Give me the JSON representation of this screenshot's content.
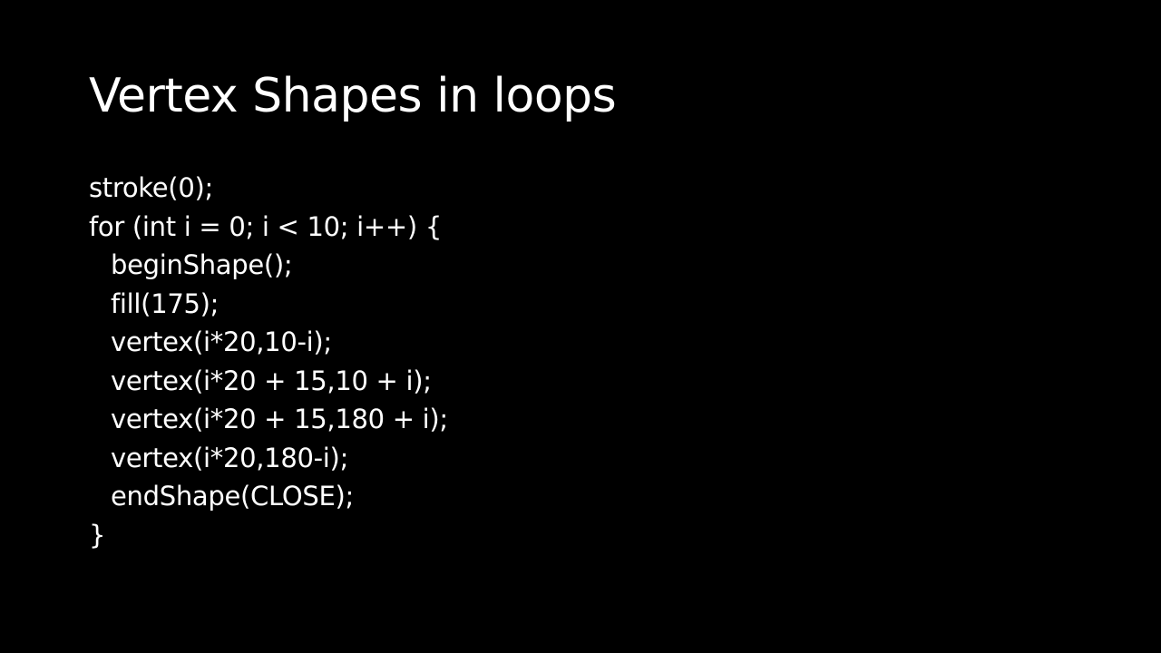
{
  "slide": {
    "title": "Vertex Shapes in loops",
    "background_color": "#000000",
    "text_color": "#ffffff",
    "code_lines": [
      {
        "text": "stroke(0);",
        "indent": 0
      },
      {
        "text": "for (int i = 0; i < 10; i++) {",
        "indent": 0
      },
      {
        "text": "beginShape();",
        "indent": 1
      },
      {
        "text": "fill(175);",
        "indent": 1
      },
      {
        "text": "vertex(i*20,10-i);",
        "indent": 1
      },
      {
        "text": "vertex(i*20 + 15,10 + i);",
        "indent": 1
      },
      {
        "text": "vertex(i*20 + 15,180 + i);",
        "indent": 1
      },
      {
        "text": "vertex(i*20,180-i);",
        "indent": 1
      },
      {
        "text": "endShape(CLOSE);",
        "indent": 1
      },
      {
        "text": "}",
        "indent": 0
      }
    ]
  }
}
